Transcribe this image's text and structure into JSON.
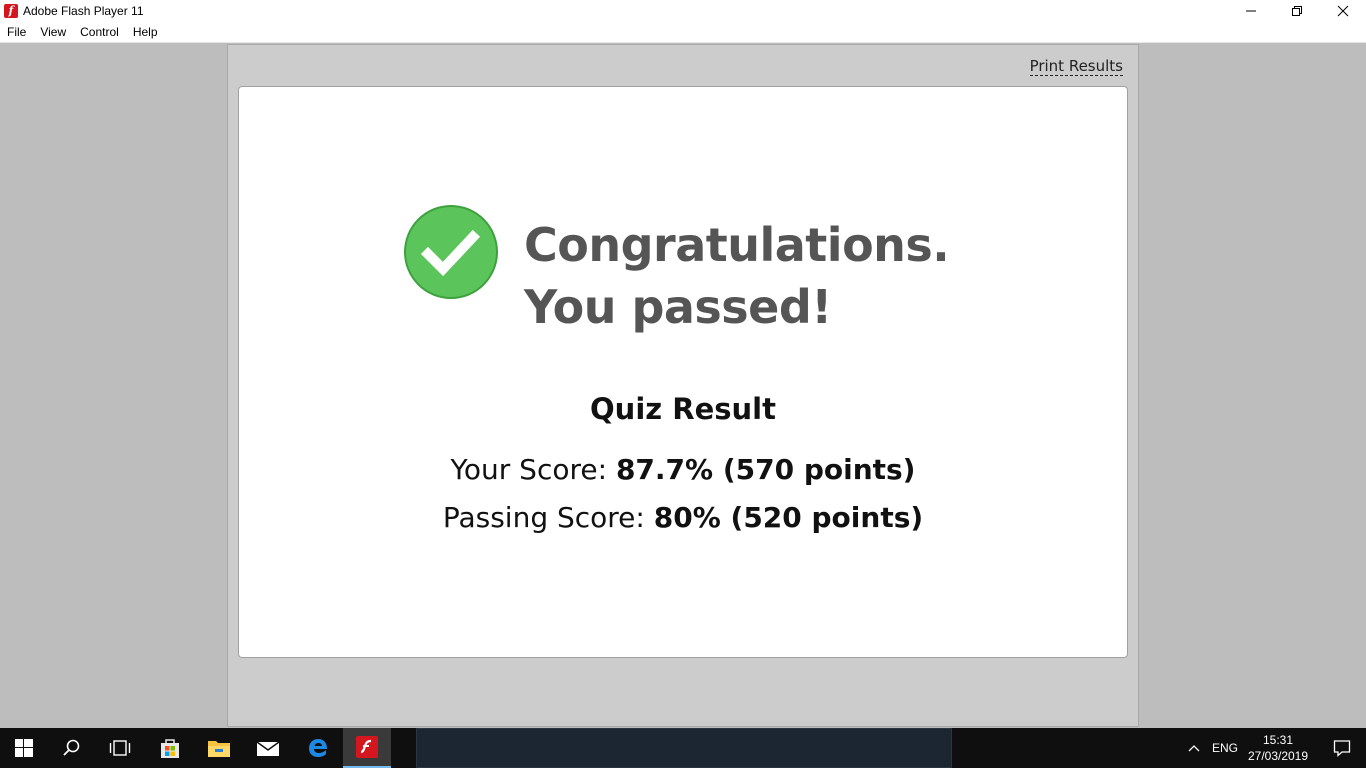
{
  "window": {
    "title": "Adobe Flash Player 11",
    "icon": "flash-player-icon",
    "icon_glyph": "f"
  },
  "menu": {
    "items": [
      "File",
      "View",
      "Control",
      "Help"
    ]
  },
  "stage": {
    "print_link": "Print Results",
    "headline": {
      "line1": "Congratulations.",
      "line2": "You passed!"
    },
    "quiz_title": "Quiz Result",
    "your_score_label": "Your Score:",
    "your_score_value": "87.7% (570 points)",
    "passing_score_label": "Passing Score:",
    "passing_score_value": "80% (520 points)",
    "colors": {
      "check_green": "#5bc45a",
      "headline_gray": "#555555"
    }
  },
  "taskbar": {
    "icons": [
      "windows-start-icon",
      "search-icon",
      "task-view-icon",
      "store-icon",
      "file-explorer-icon",
      "mail-icon",
      "edge-icon",
      "flash-player-icon"
    ],
    "language": "ENG",
    "time": "15:31",
    "date": "27/03/2019"
  }
}
